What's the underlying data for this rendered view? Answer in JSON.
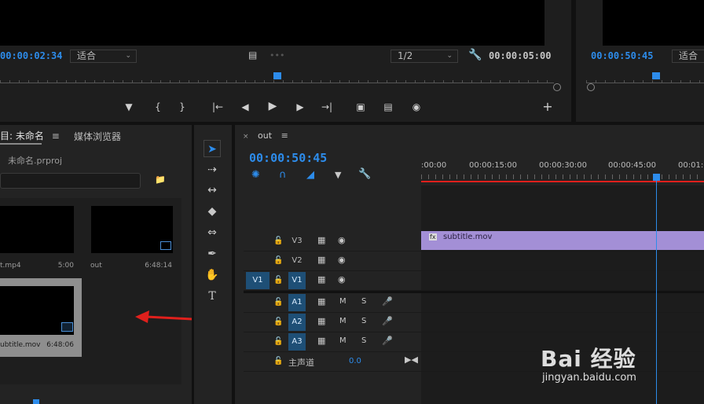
{
  "source_monitor": {
    "timecode": "00:00:02:34",
    "fit_select": "适合",
    "resolution_select": "1/2",
    "duration": "00:00:05:00"
  },
  "program_monitor": {
    "timecode": "00:00:50:45",
    "fit_select": "适合"
  },
  "project_panel": {
    "tab_project": "目: 未命名",
    "tab_media": "媒体浏览器",
    "project_file": "未命名.prproj",
    "items": [
      {
        "name": "t.mp4",
        "duration": "5:00"
      },
      {
        "name": "out",
        "duration": "6:48:14"
      },
      {
        "name": "ubtitle.mov",
        "duration": "6:48:06"
      }
    ]
  },
  "timeline": {
    "sequence_tab": "out",
    "close_glyph": "×",
    "menu_glyph": "≡",
    "timecode": "00:00:50:45",
    "ruler_labels": [
      ":00:00",
      "00:00:15:00",
      "00:00:30:00",
      "00:00:45:00",
      "00:01:0"
    ],
    "video_tracks": [
      {
        "name": "V3"
      },
      {
        "name": "V2"
      },
      {
        "name": "V1"
      }
    ],
    "audio_tracks": [
      {
        "name": "A1",
        "m": "M",
        "s": "S"
      },
      {
        "name": "A2",
        "m": "M",
        "s": "S"
      },
      {
        "name": "A3",
        "m": "M",
        "s": "S"
      }
    ],
    "source_patch": "V1",
    "master_label": "主声道",
    "master_value": "0.0",
    "clip_name": "subtitle.mov",
    "clip_fx": "fx"
  },
  "watermark": {
    "brand": "Bai 经验",
    "url": "jingyan.baidu.com"
  },
  "colors": {
    "accent": "#2d8ceb",
    "clip": "#a38fd6",
    "track_on": "#1e4f76",
    "arrow": "#e0201c"
  }
}
